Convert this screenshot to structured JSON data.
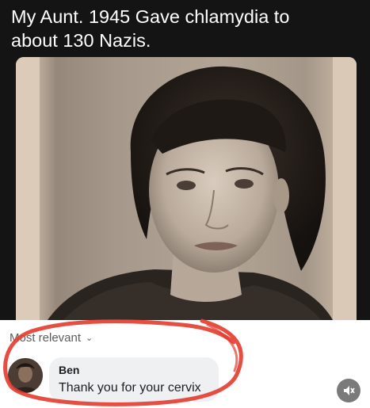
{
  "post": {
    "caption": "My Aunt.  1945  Gave chlamydia to\nabout 130 Nazis."
  },
  "comments": {
    "sort_label": "Most relevant",
    "items": [
      {
        "author": "Ben",
        "text": "Thank you for your cervix"
      }
    ]
  },
  "controls": {
    "mute_icon": "speaker-muted-icon"
  },
  "colors": {
    "highlight_circle": "#e33b2e",
    "bubble_bg": "#eef0f2",
    "post_bg": "#141414"
  }
}
